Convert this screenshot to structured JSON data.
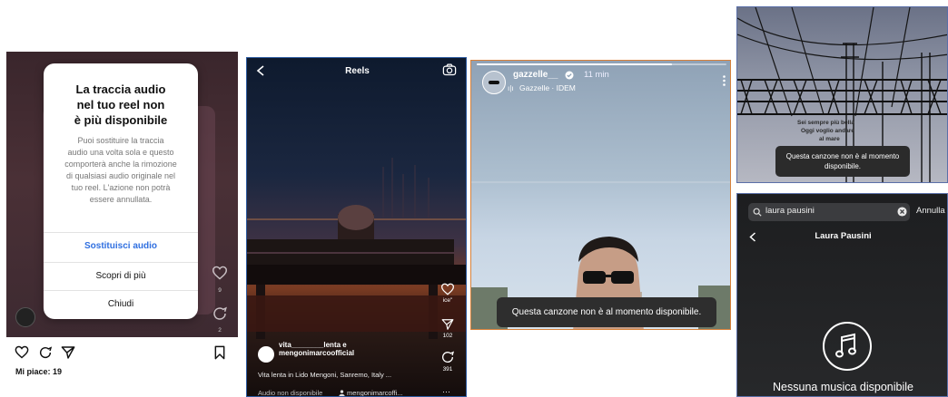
{
  "panel1": {
    "modal": {
      "title": "La traccia audio\nnel tuo reel non\nè più disponibile",
      "body": "Puoi sostituire la traccia\naudio una volta sola e questo\ncomporterà anche la rimozione\ndi qualsiasi audio originale nel\ntuo reel. L'azione non potrà\nessere annullata.",
      "replace_label": "Sostituisci audio",
      "learn_more_label": "Scopri di più",
      "close_label": "Chiudi"
    },
    "side_counts": {
      "likes": "9",
      "comments": "2"
    },
    "likes_text": "Mi piace: 19",
    "accent": "#2f6fe0"
  },
  "panel2": {
    "title": "Reels",
    "handles": "vita________lenta e\nmengonimarcoofficial",
    "caption": "Vita lenta in Lido Mengoni, Sanremo, Italy ...",
    "audio_status": "Audio non disponibile",
    "audio_user": "mengonimarcoffi...",
    "like_count": "ice\"",
    "share_count": "102",
    "comment_count": "391",
    "more": "···"
  },
  "panel3": {
    "username": "gazzelle__",
    "time": "11 min",
    "music": "Gazzelle · IDEM",
    "toast": "Questa canzone non è al momento disponibile."
  },
  "panel4": {
    "overlay_line1": "Sei sempre più bella",
    "overlay_line2": "Oggi voglio andare",
    "overlay_line3": "al mare",
    "toast": "Questa canzone non è al momento\ndisponibile."
  },
  "panel5": {
    "search_query": "laura pausini",
    "cancel_label": "Annulla",
    "title": "Laura Pausini",
    "empty_text": "Nessuna musica disponibile"
  }
}
